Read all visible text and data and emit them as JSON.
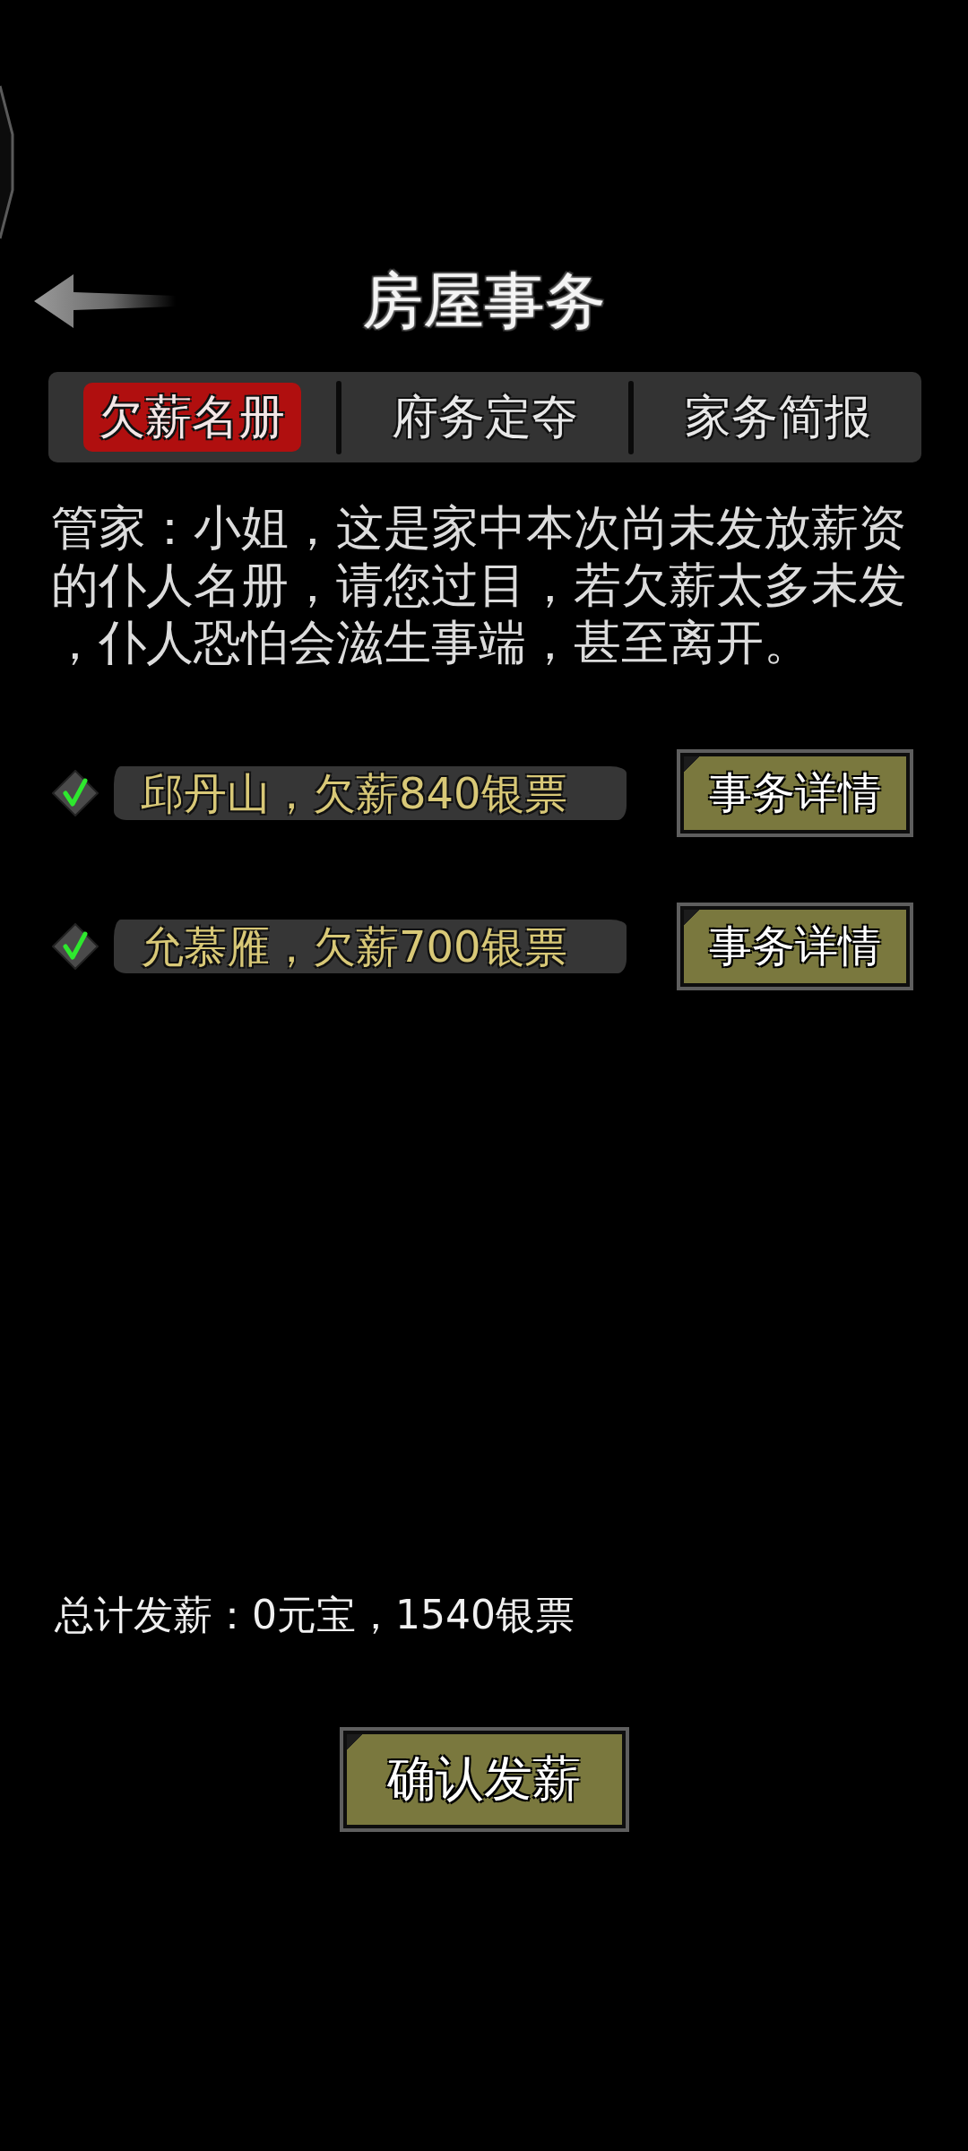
{
  "header": {
    "title": "房屋事务"
  },
  "tabs": [
    {
      "label": "欠薪名册",
      "selected": true
    },
    {
      "label": "府务定夺",
      "selected": false
    },
    {
      "label": "家务简报",
      "selected": false
    }
  ],
  "message": "管家：小姐，这是家中本次尚未发放薪资的仆人名册，请您过目，若欠薪太多未发，仆人恐怕会滋生事端，甚至离开。",
  "servants": [
    {
      "checked": true,
      "label": "邱丹山，欠薪840银票",
      "button": "事务详情"
    },
    {
      "checked": true,
      "label": "允慕雁，欠薪700银票",
      "button": "事务详情"
    }
  ],
  "total": "总计发薪：0元宝，1540银票",
  "confirm_button": "确认发薪"
}
